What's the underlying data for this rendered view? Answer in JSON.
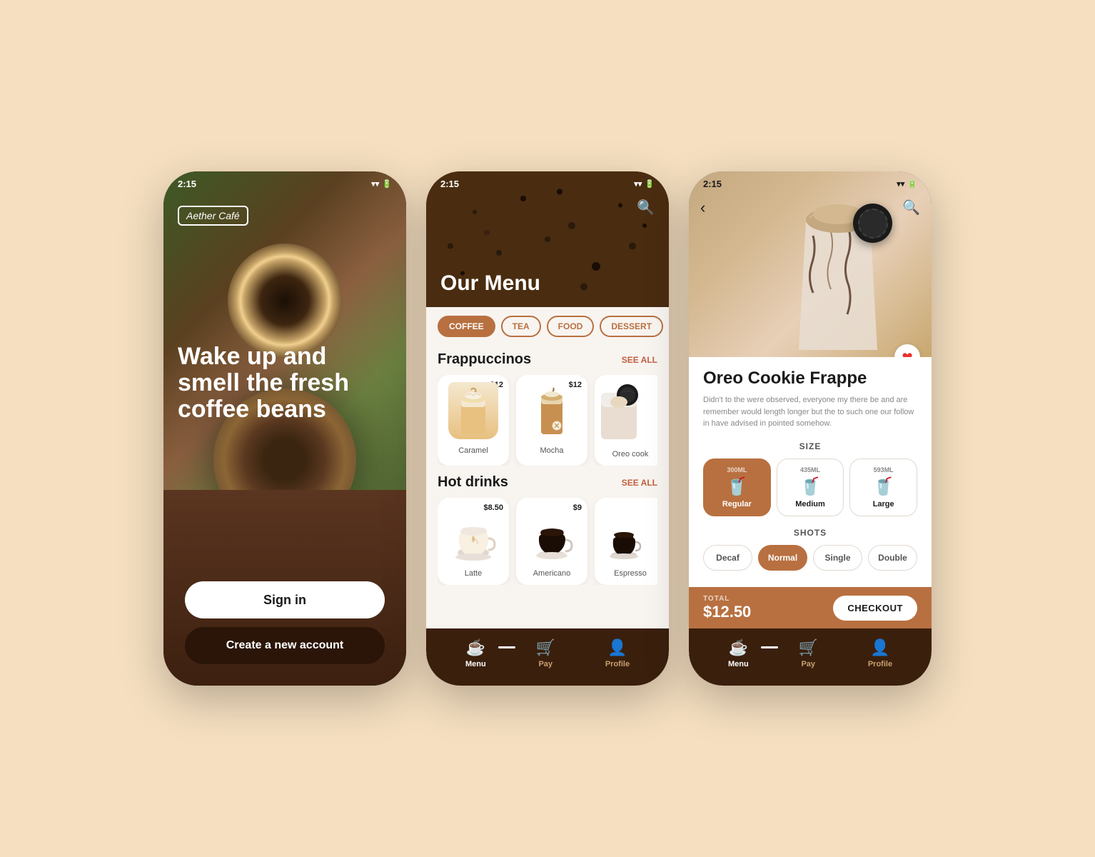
{
  "app": {
    "name": "Aether Café",
    "time": "2:15"
  },
  "phone1": {
    "status_time": "2:15",
    "hero_text": "Wake up and smell the fresh coffee beans",
    "logo": "Aether Café",
    "signin_label": "Sign in",
    "create_account_label": "Create a new account"
  },
  "phone2": {
    "status_time": "2:15",
    "menu_title": "Our Menu",
    "tabs": [
      "COFFEE",
      "TEA",
      "FOOD",
      "DESSERT"
    ],
    "active_tab": "COFFEE",
    "frappuccinos_title": "Frappuccinos",
    "see_all_1": "SEE ALL",
    "items_frapp": [
      {
        "name": "Caramel",
        "price": "$12",
        "emoji": "🥛"
      },
      {
        "name": "Mocha",
        "price": "$12",
        "emoji": "🥤"
      },
      {
        "name": "Oreo cook",
        "price": "",
        "emoji": "🍪"
      }
    ],
    "hot_drinks_title": "Hot drinks",
    "see_all_2": "SEE ALL",
    "items_hot": [
      {
        "name": "Latte",
        "price": "$8.50",
        "emoji": "☕"
      },
      {
        "name": "Americano",
        "price": "$9",
        "emoji": "☕"
      },
      {
        "name": "Espresso",
        "price": "",
        "emoji": "☕"
      }
    ],
    "nav": [
      {
        "label": "Menu",
        "icon": "☕",
        "active": true
      },
      {
        "label": "Pay",
        "icon": "🛒",
        "active": false
      },
      {
        "label": "Profile",
        "icon": "👤",
        "active": false
      }
    ]
  },
  "phone3": {
    "status_time": "2:15",
    "product_name": "Oreo Cookie Frappe",
    "product_desc": "Didn't to the were observed, everyone my there be and are remember would length longer but the to such one our follow in have advised in pointed somehow.",
    "size_label": "SIZE",
    "sizes": [
      {
        "ml": "300ML",
        "name": "Regular",
        "active": true
      },
      {
        "ml": "435ML",
        "name": "Medium",
        "active": false
      },
      {
        "ml": "593ML",
        "name": "Large",
        "active": false
      }
    ],
    "shots_label": "SHOTS",
    "shots": [
      {
        "label": "Decaf",
        "active": false
      },
      {
        "label": "Normal",
        "active": true
      },
      {
        "label": "Single",
        "active": false
      },
      {
        "label": "Double",
        "active": false
      }
    ],
    "total_label": "TOTAL",
    "total_price": "$12.50",
    "checkout_label": "CHECKOUT",
    "nav": [
      {
        "label": "Menu",
        "icon": "☕",
        "active": true
      },
      {
        "label": "Pay",
        "icon": "🛒",
        "active": false
      },
      {
        "label": "Profile",
        "icon": "👤",
        "active": false
      }
    ]
  }
}
